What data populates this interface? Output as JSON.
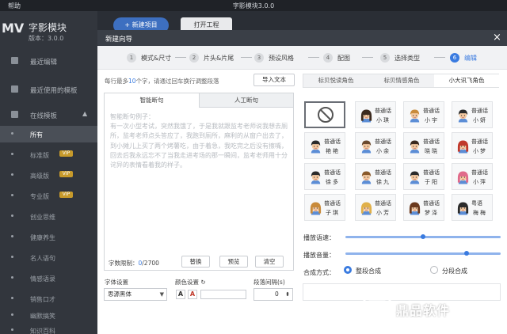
{
  "app": {
    "title": "字影模块3.0.0",
    "menu_help": "帮助",
    "logo": "MV",
    "name": "字影模块",
    "version": "版本：3.0.0"
  },
  "sidebar": {
    "items": [
      {
        "label": "最近编辑"
      },
      {
        "label": "最近使用的模板"
      },
      {
        "label": "在线模板",
        "chevron": "▲"
      }
    ],
    "sub_items": [
      {
        "label": "所有",
        "active": true
      },
      {
        "label": "标准版",
        "badge": "VIP"
      },
      {
        "label": "高级版",
        "badge": "VIP"
      },
      {
        "label": "专业版",
        "badge": "VIP"
      },
      {
        "label": "创业思维"
      },
      {
        "label": "健康养生"
      },
      {
        "label": "名人语句"
      },
      {
        "label": "情感语录"
      },
      {
        "label": "销售口才"
      },
      {
        "label": "幽默搞笑"
      },
      {
        "label": "知识百科"
      }
    ]
  },
  "topbar": {
    "new_project": "+ 新建项目",
    "open_project": "打开工程"
  },
  "dialog": {
    "title": "新建向导",
    "close": "×",
    "steps": [
      {
        "num": "1",
        "label": "模式&尺寸"
      },
      {
        "num": "2",
        "label": "片头&片尾"
      },
      {
        "num": "3",
        "label": "预设风格"
      },
      {
        "num": "4",
        "label": "配图"
      },
      {
        "num": "5",
        "label": "选择类型"
      },
      {
        "num": "6",
        "label": "编辑",
        "active": true
      }
    ],
    "hint_pre": "每行最多",
    "hint_num": "10",
    "hint_post": "个字，请通过回车换行调整段落",
    "import_text": "导入文本",
    "tabs": [
      "智能断句",
      "人工断句"
    ],
    "placeholder": "智能断句例子：\n有一次小型考试，突然我饿了，于是我就跟监考老师说我想去厕所，监考老师点头答应了，我跑到厕所，麻利的从窗户出去了，到小摊儿上买了两个烤薯吃，由于着急，我吃完之后没有擦嘴，回去后我永远忘不了当我走进考场的那一瞬间，监考老师用十分诧异的表情看着我的样子。",
    "word_limit_label": "字数限制：",
    "word_count": "0",
    "word_max": "/2700",
    "replace_btn": "替换",
    "preview_btn": "预览",
    "clear_btn": "清空",
    "font_label": "字体设置",
    "font_value": "思源黑体",
    "color_label": "颜色设置",
    "color_refresh": "↻",
    "color_a1": "A",
    "color_a2": "A",
    "spacing_label": "段落间隔(s)",
    "spacing_value": "0",
    "spin": "⬍"
  },
  "voices": {
    "tabs": [
      "标贝悦读角色",
      "标贝情感角色",
      "小大讯飞角色"
    ],
    "active_tab": 2,
    "grid": [
      {
        "type": "普通话",
        "name": "小琪",
        "hair": "#3b2a1e",
        "kind": "f"
      },
      {
        "type": "普通话",
        "name": "小宇",
        "hair": "#c98b3b",
        "kind": "m"
      },
      {
        "type": "普通话",
        "name": "小妍",
        "hair": "#2b2b2b",
        "kind": "m"
      },
      {
        "type": "普通话",
        "name": "艳艳",
        "hair": "#2b2b2b",
        "kind": "m"
      },
      {
        "type": "普通话",
        "name": "小余",
        "hair": "#6b4a2e",
        "kind": "m"
      },
      {
        "type": "普通话",
        "name": "晓晓",
        "hair": "#3b2a1e",
        "kind": "m"
      },
      {
        "type": "普通话",
        "name": "小梦",
        "hair": "#c0392b",
        "kind": "f"
      },
      {
        "type": "普通话",
        "name": "徐多",
        "hair": "#2b2b2b",
        "kind": "m"
      },
      {
        "type": "普通话",
        "name": "徐九",
        "hair": "#8a5a2b",
        "kind": "m"
      },
      {
        "type": "普通话",
        "name": "于阳",
        "hair": "#2b2b2b",
        "kind": "m"
      },
      {
        "type": "普通话",
        "name": "小萍",
        "hair": "#e06a8a",
        "kind": "f"
      },
      {
        "type": "普通话",
        "name": "子琪",
        "hair": "#c98b3b",
        "kind": "f"
      },
      {
        "type": "普通话",
        "name": "小芳",
        "hair": "#e0b04a",
        "kind": "f"
      },
      {
        "type": "普通话",
        "name": "梦泽",
        "hair": "#6b3a1e",
        "kind": "f"
      },
      {
        "type": "粤语",
        "name": "梅梅",
        "hair": "#2b2b2b",
        "kind": "f"
      }
    ],
    "speed_label": "播放语速：",
    "speed": 0.5,
    "volume_label": "播放音量：",
    "volume": 0.78,
    "synth_label": "合成方式：",
    "synth_options": [
      "整段合成",
      "分段合成"
    ],
    "synth_selected": 0
  },
  "watermark": {
    "text": "鼎品软件"
  },
  "colors": {
    "accent": "#3a7be0",
    "sidebar": "#32363d",
    "header": "#3a3f47"
  }
}
